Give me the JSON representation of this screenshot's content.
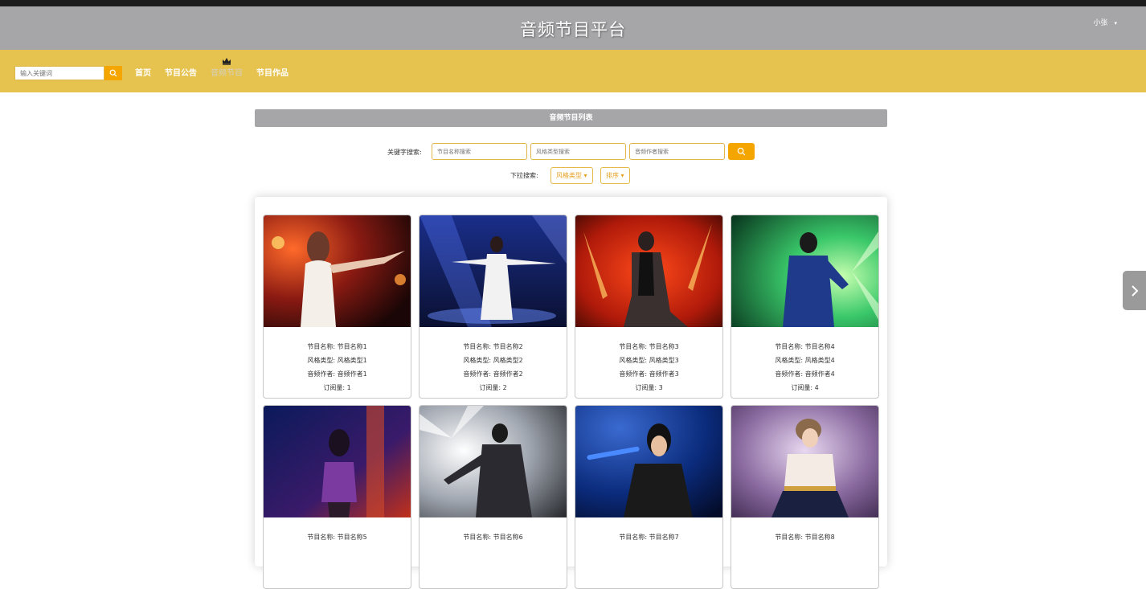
{
  "header": {
    "site_title": "音频节目平台",
    "user_name": "小张",
    "user_caret": "▾"
  },
  "nav": {
    "search_placeholder": "输入关键词",
    "items": [
      {
        "label": "首页"
      },
      {
        "label": "节目公告"
      },
      {
        "label": "音频节目"
      },
      {
        "label": "节目作品"
      }
    ],
    "active_index": 2
  },
  "panel": {
    "title": "音频节目列表",
    "keyword_label": "关键字搜索:",
    "keyword_placeholders": [
      "节目名称搜索",
      "风格类型搜索",
      "音频作者搜索"
    ],
    "dropdown_label": "下拉搜索:",
    "dropdowns": [
      "风格类型 ▾",
      "排序 ▾"
    ]
  },
  "programs": [
    {
      "name": "节目名称: 节目名称1",
      "style": "风格类型: 风格类型1",
      "author": "音频作者: 音频作者1",
      "subs": "订阅量: 1"
    },
    {
      "name": "节目名称: 节目名称2",
      "style": "风格类型: 风格类型2",
      "author": "音频作者: 音频作者2",
      "subs": "订阅量: 2"
    },
    {
      "name": "节目名称: 节目名称3",
      "style": "风格类型: 风格类型3",
      "author": "音频作者: 音频作者3",
      "subs": "订阅量: 3"
    },
    {
      "name": "节目名称: 节目名称4",
      "style": "风格类型: 风格类型4",
      "author": "音频作者: 音频作者4",
      "subs": "订阅量: 4"
    },
    {
      "name": "节目名称: 节目名称5",
      "style": "",
      "author": "",
      "subs": ""
    },
    {
      "name": "节目名称: 节目名称6",
      "style": "",
      "author": "",
      "subs": ""
    },
    {
      "name": "节目名称: 节目名称7",
      "style": "",
      "author": "",
      "subs": ""
    },
    {
      "name": "节目名称: 节目名称8",
      "style": "",
      "author": "",
      "subs": ""
    }
  ],
  "colors": {
    "title_bar": "#a6a6a8",
    "nav_bar": "#e6c34e",
    "accent": "#f5a500"
  }
}
